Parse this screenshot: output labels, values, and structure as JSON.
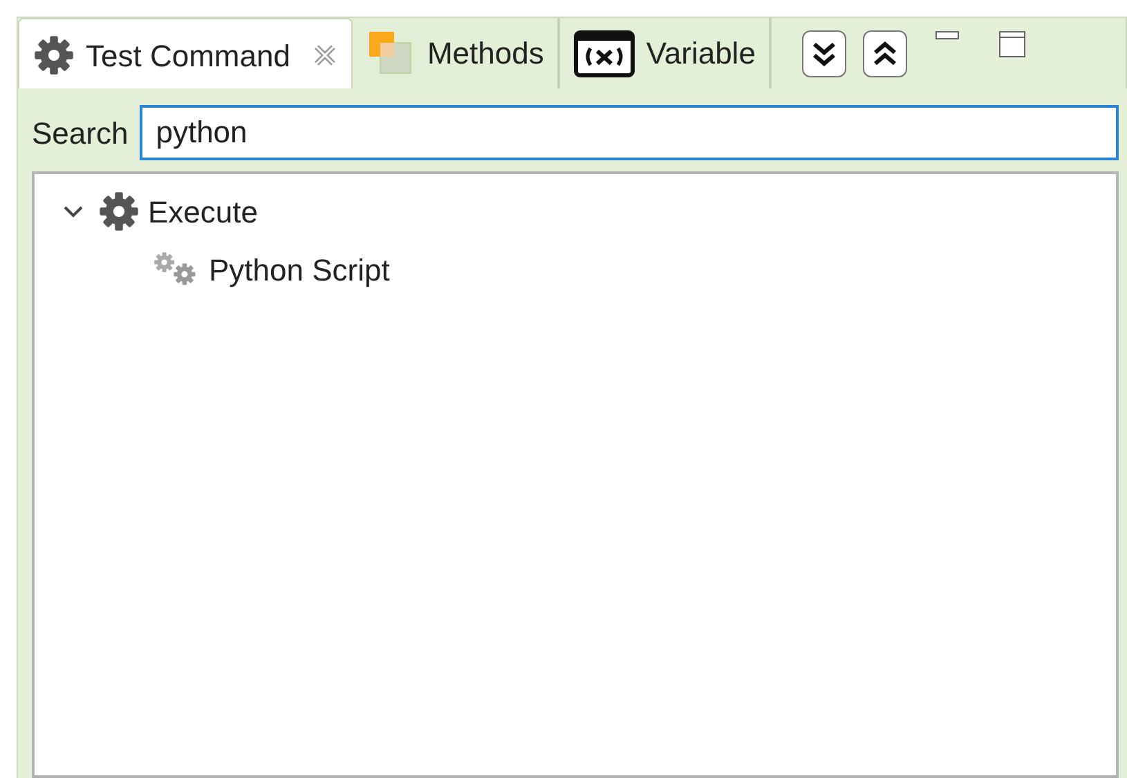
{
  "tabs": [
    {
      "label": "Test Command",
      "kind": "gear",
      "selected": true
    },
    {
      "label": "Methods",
      "kind": "squares",
      "selected": false
    },
    {
      "label": "Variable",
      "kind": "variable",
      "selected": false
    }
  ],
  "search": {
    "label": "Search",
    "value": "python"
  },
  "tree": [
    {
      "label": "Execute",
      "kind": "gear",
      "expanded": true,
      "children": [
        {
          "label": "Python Script",
          "kind": "gears"
        }
      ]
    }
  ]
}
